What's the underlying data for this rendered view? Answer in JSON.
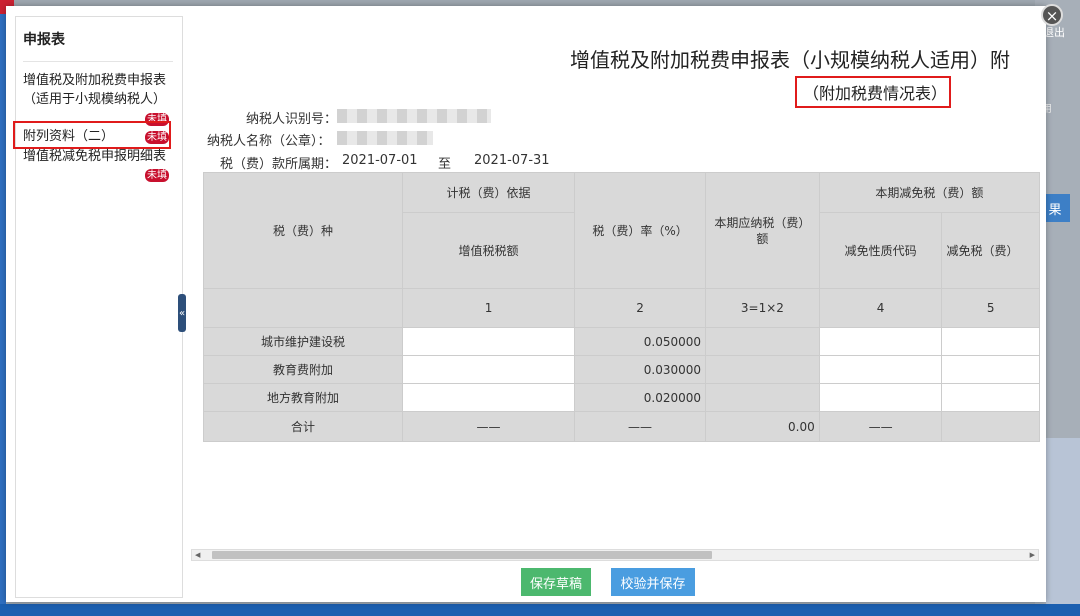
{
  "background": {
    "logout_label": "退出",
    "tab_label": "用",
    "button_label": "果"
  },
  "sidebar": {
    "title": "申报表",
    "items": [
      {
        "label_line1": "增值税及附加税费申报表",
        "label_line2": "（适用于小规模纳税人）",
        "badge": "未填"
      },
      {
        "label_line1": "附列资料（二）",
        "badge": "未填"
      },
      {
        "label_line1": "增值税减免税申报明细表",
        "badge": "未填"
      }
    ]
  },
  "form": {
    "title": "增值税及附加税费申报表（小规模纳税人适用）附",
    "subtitle": "（附加税费情况表）",
    "taxpayer_id_label": "纳税人识别号：",
    "taxpayer_name_label": "纳税人名称（公章）：",
    "period_label": "税（费）款所属期：",
    "period_start": "2021-07-01",
    "period_to": "至",
    "period_end": "2021-07-31"
  },
  "table": {
    "h_tax_type": "税（费）种",
    "h_basis": "计税（费）依据",
    "h_vat_amount": "增值税税额",
    "h_rate": "税（费）率（%）",
    "h_payable": "本期应纳税（费）额",
    "h_reduction": "本期减免税（费）额",
    "h_reduction_code": "减免性质代码",
    "h_reduction_amount": "减免税（费）",
    "col_nums": [
      "1",
      "2",
      "3=1×2",
      "4",
      "5"
    ],
    "rows": [
      {
        "name": "城市维护建设税",
        "rate": "0.050000"
      },
      {
        "name": "教育费附加",
        "rate": "0.030000"
      },
      {
        "name": "地方教育附加",
        "rate": "0.020000"
      }
    ],
    "total": {
      "name": "合计",
      "basis": "——",
      "rate": "——",
      "payable": "0.00",
      "code": "——"
    }
  },
  "buttons": {
    "save_draft": "保存草稿",
    "validate_save": "校验并保存"
  }
}
